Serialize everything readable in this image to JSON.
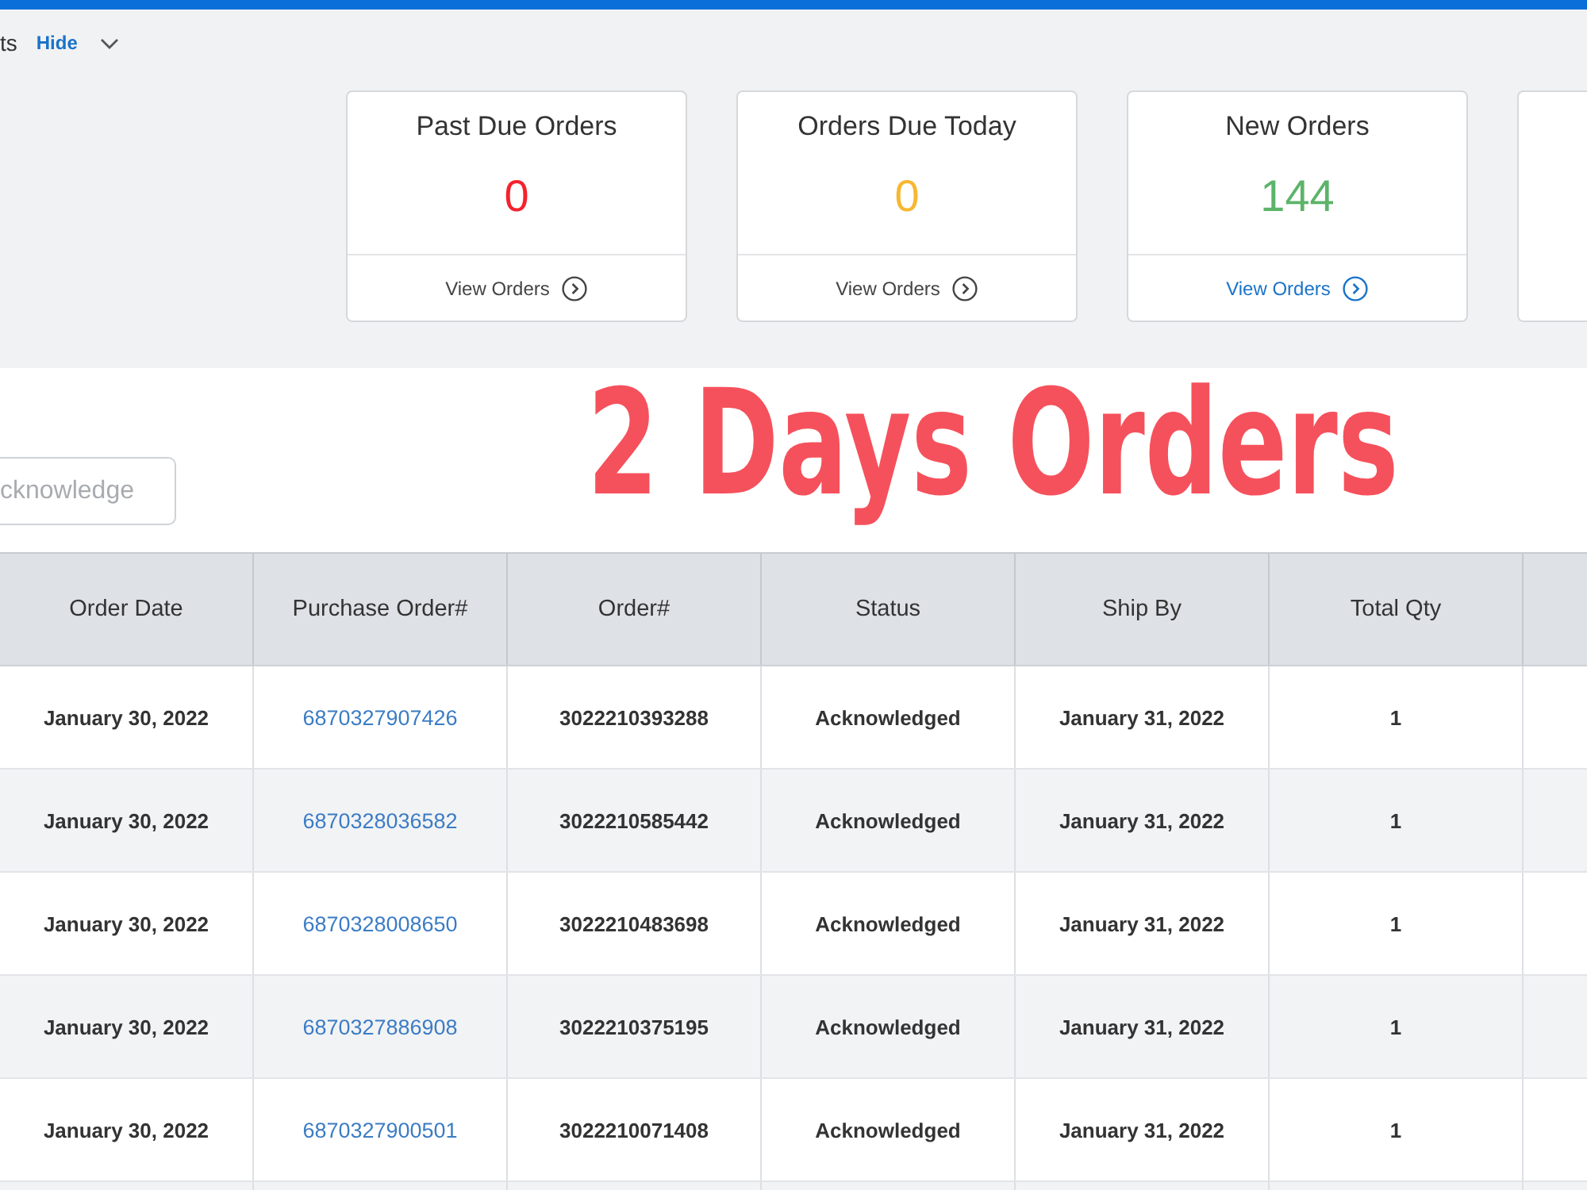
{
  "header": {
    "title": "ts",
    "toggle_link": "Hide"
  },
  "cards": [
    {
      "title": "Past Due Orders",
      "value": "0",
      "color": "#f5222d",
      "link": "View Orders",
      "selected": false
    },
    {
      "title": "Orders Due Today",
      "value": "0",
      "color": "#f7b731",
      "link": "View Orders",
      "selected": false
    },
    {
      "title": "New Orders",
      "value": "144",
      "color": "#5cb46a",
      "link": "View Orders",
      "selected": true
    }
  ],
  "partial_card": true,
  "toolbar": {
    "button": {
      "label": "cknowledge",
      "disabled": true
    }
  },
  "annotation": "2 Days Orders",
  "table": {
    "columns": [
      "Order Date",
      "Purchase Order#",
      "Order#",
      "Status",
      "Ship By",
      "Total Qty"
    ],
    "partial_column": true,
    "rows": [
      {
        "order_date": "January 30, 2022",
        "purchase_order": "6870327907426",
        "order_no": "3022210393288",
        "status": "Acknowledged",
        "ship_by": "January 31, 2022",
        "total_qty": "1"
      },
      {
        "order_date": "January 30, 2022",
        "purchase_order": "6870328036582",
        "order_no": "3022210585442",
        "status": "Acknowledged",
        "ship_by": "January 31, 2022",
        "total_qty": "1"
      },
      {
        "order_date": "January 30, 2022",
        "purchase_order": "6870328008650",
        "order_no": "3022210483698",
        "status": "Acknowledged",
        "ship_by": "January 31, 2022",
        "total_qty": "1"
      },
      {
        "order_date": "January 30, 2022",
        "purchase_order": "6870327886908",
        "order_no": "3022210375195",
        "status": "Acknowledged",
        "ship_by": "January 31, 2022",
        "total_qty": "1"
      },
      {
        "order_date": "January 30, 2022",
        "purchase_order": "6870327900501",
        "order_no": "3022210071408",
        "status": "Acknowledged",
        "ship_by": "January 31, 2022",
        "total_qty": "1"
      }
    ],
    "partial_row": true
  }
}
